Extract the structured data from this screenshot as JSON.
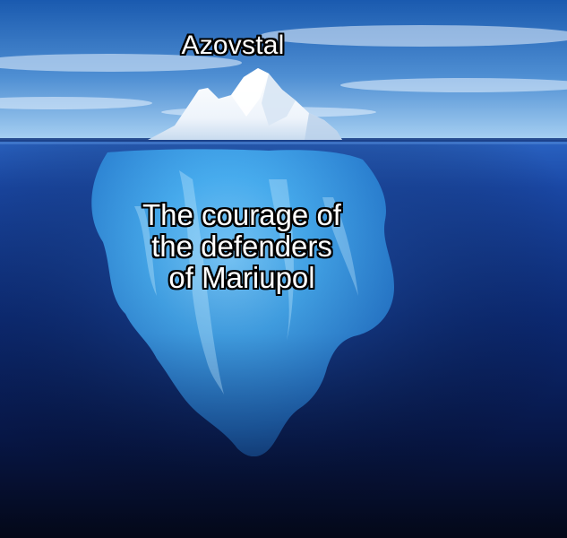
{
  "meme": {
    "top_label": "Azovstal",
    "bottom_label_lines": [
      "The courage of",
      "the defenders",
      "of Mariupol"
    ]
  },
  "colors": {
    "sky_top": "#1f63b5",
    "sky_bottom": "#8fc3ee",
    "water_surface": "#1d4fa8",
    "deep_water": "#050a1c",
    "ice_above": "#f4f8fc",
    "ice_below": "#3ea3e8",
    "caption_text": "#ffffff",
    "caption_outline": "#000000"
  }
}
